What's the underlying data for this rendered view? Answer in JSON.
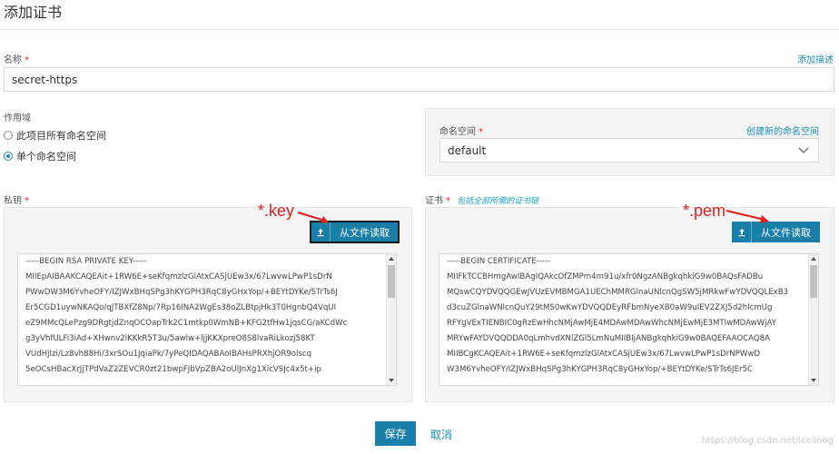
{
  "page": {
    "title": "添加证书"
  },
  "name_field": {
    "label": "名称",
    "required": "*",
    "value": "secret-https",
    "add_desc_link": "添加描述"
  },
  "scope": {
    "label": "作用域",
    "options": [
      {
        "label": "此项目所有命名空间",
        "checked": false
      },
      {
        "label": "单个命名空间",
        "checked": true
      }
    ]
  },
  "namespace": {
    "label": "命名空间",
    "required": "*",
    "create_link": "创建新的命名空间",
    "value": "default"
  },
  "private_key": {
    "label": "私钥",
    "required": "*",
    "upload_label": "从文件读取",
    "annotation": "*.key",
    "lines": [
      "-----BEGIN RSA PRIVATE KEY-----",
      "MIIEpAIBAAKCAQEAit+1RW6E+seKfqmzlzGlAtxCASjUEw3x/67LwvwLPwP1sDrN",
      "PWwDW3M6YvheOFY/IZJWxBHqSPg3hKYGPH3RqC8yGHxYop/+BEYtDYKe/STrTs6J",
      "Er5CGD1uywNKAQo/qJTBXfZ8Np/7Rp16lNA2WgEs38oZLBtpjHk3T0HgnbQ4VqUI",
      "eZ9MMcQLePzg9DRgtjdZnqOCOapTrk2C1mtkp0WmNB+KFG2tfHw1jqsCG/aKCdWc",
      "g3yVhfULFi3iAd+XHwnv2lKKkR5T3u/5awlw+ljjKKXpreO8S8lvaRiLkozj58KT",
      "VUdHjIzi/Lz8vh88Hi/3xrSOu1JqiaPk/7yPeQIDAQABAoIBAHsPRXhjOR9olscq",
      "5eOCsHBacXrJjTPdVaZ2ZEVCR0zt21bwpFJbVpZBA2oUlJnXg1XicVSJc4x5t+ip"
    ]
  },
  "certificate": {
    "label": "证书",
    "required": "*",
    "hint": "包括全部所需的证书链",
    "upload_label": "从文件读取",
    "annotation": "*.pem",
    "lines": [
      "-----BEGIN CERTIFICATE-----",
      "MIIFkTCCBHmgAwIBAgIQAkcOfZMPm4m91u/xfr0NgzANBgkqhkiG9w0BAQsFADBu",
      "MQswCQYDVQQGEwJVUzEVMBMGA1UEChMMRGlnaUNlcnQgSW5jMRkwFwYDVQQLExB3",
      "d3cuZGlnaWNlcnQuY29tMS0wKwYDVQQDEyRFbmNyeXB0aW9uIEV2ZXJ5d2hlcmUg",
      "RFYgVExTIENBIC0gRzEwHhcNMjAwMjE4MDAwMDAwWhcNMjEwMjE3MTIwMDAwWjAY",
      "MRYwFAYDVQQDDA0qLmhvdXNlZGl5LmNuMIIBIjANBgkqhkiG9w0BAQEFAAOCAQ8A",
      "MIIBCgKCAQEAit+1RW6E+seKfqmzlzGlAtxCASjUEw3x/67LwvwLPwP1sDrNPWwD",
      "W3M6YvheOFY/IZJWxBHqSPg3hKYGPH3RqC8yGHxYop/+BEYtDYKe/STrTs6JEr5C"
    ]
  },
  "actions": {
    "save": "保存",
    "cancel": "取消"
  },
  "watermark": "https://blog.csdn.net/icelioog",
  "colors": {
    "accent": "#1a7fa8",
    "link": "#1a8bb8",
    "annotation": "#e02020"
  }
}
